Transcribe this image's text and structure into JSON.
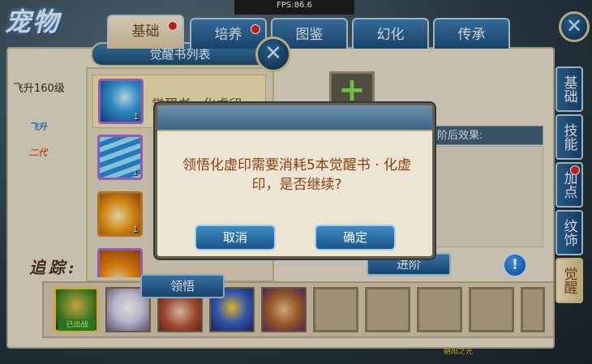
{
  "fps": "FPS:86.6",
  "logo": "宠物",
  "tabs": [
    {
      "label": "基础",
      "active": true,
      "badge": true
    },
    {
      "label": "培养",
      "active": false,
      "badge": true
    },
    {
      "label": "图鉴",
      "active": false,
      "badge": false
    },
    {
      "label": "幻化",
      "active": false,
      "badge": false
    },
    {
      "label": "传承",
      "active": false,
      "badge": false
    }
  ],
  "book_panel": {
    "title": "觉醒书列表",
    "books": [
      {
        "name": "觉醒书 · 化虚印",
        "count": "1",
        "selected": true
      },
      {
        "name": "",
        "count": "1",
        "selected": false
      },
      {
        "name": "",
        "count": "1",
        "selected": false
      }
    ]
  },
  "left": {
    "level": "飞升160级",
    "badge1": "飞升",
    "badge2": "二代",
    "team_label": "追踪:"
  },
  "right": {
    "effect_label": "阶后效果:",
    "advance_button": "进阶",
    "info_icon": "!"
  },
  "side_tabs": [
    "基础",
    "技能",
    "加点",
    "纹饰",
    "觉醒"
  ],
  "bottom": {
    "learn_button": "领悟",
    "pet_tag": "已出战",
    "footer_text": "朝阳之光"
  },
  "dialog": {
    "message": "领悟化虚印需要消耗5本觉醒书 · 化虚印，是否继续?",
    "cancel": "取消",
    "confirm": "确定"
  },
  "colors": {
    "accent_blue": "#1f4f7c",
    "parchment": "#e9e1cd",
    "dialog_text": "#8b3d12",
    "badge_red": "#e32020"
  }
}
